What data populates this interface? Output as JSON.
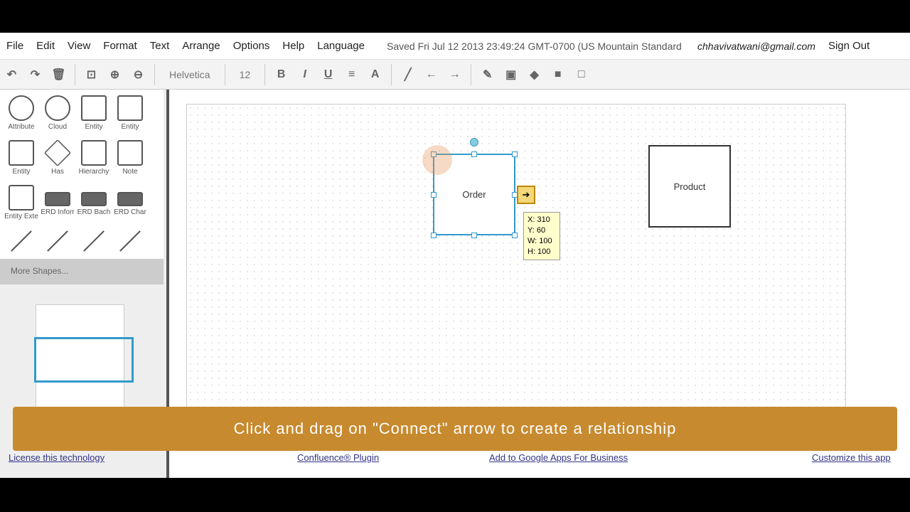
{
  "menu": [
    "File",
    "Edit",
    "View",
    "Format",
    "Text",
    "Arrange",
    "Options",
    "Help",
    "Language"
  ],
  "saved": "Saved Fri Jul 12 2013 23:49:24 GMT-0700 (US Mountain Standard Time)",
  "user": "chhavivatwani@gmail.com",
  "signout": "Sign Out",
  "toolbar": {
    "font": "Helvetica",
    "size": "12"
  },
  "shapes": [
    {
      "label": "Attribute"
    },
    {
      "label": "Cloud"
    },
    {
      "label": "Entity"
    },
    {
      "label": "Entity"
    },
    {
      "label": "Entity"
    },
    {
      "label": "Has"
    },
    {
      "label": "Hierarchy"
    },
    {
      "label": "Note"
    },
    {
      "label": "Entity Exte"
    },
    {
      "label": "ERD Inforr"
    },
    {
      "label": "ERD Bach"
    },
    {
      "label": "ERD Char"
    }
  ],
  "more_shapes": "More Shapes...",
  "canvas": {
    "order": "Order",
    "product": "Product",
    "tooltip": {
      "x": "X: 310",
      "y": "Y: 60",
      "w": "W: 100",
      "h": "H: 100"
    }
  },
  "banner": "Click and drag on \"Connect\" arrow to create a relationship",
  "footer": [
    "License this technology",
    "Confluence® Plugin",
    "Add to Google Apps For Business",
    "Customize this app"
  ],
  "colors": {
    "banner": "#c78a2e",
    "selection": "#3399cc"
  }
}
